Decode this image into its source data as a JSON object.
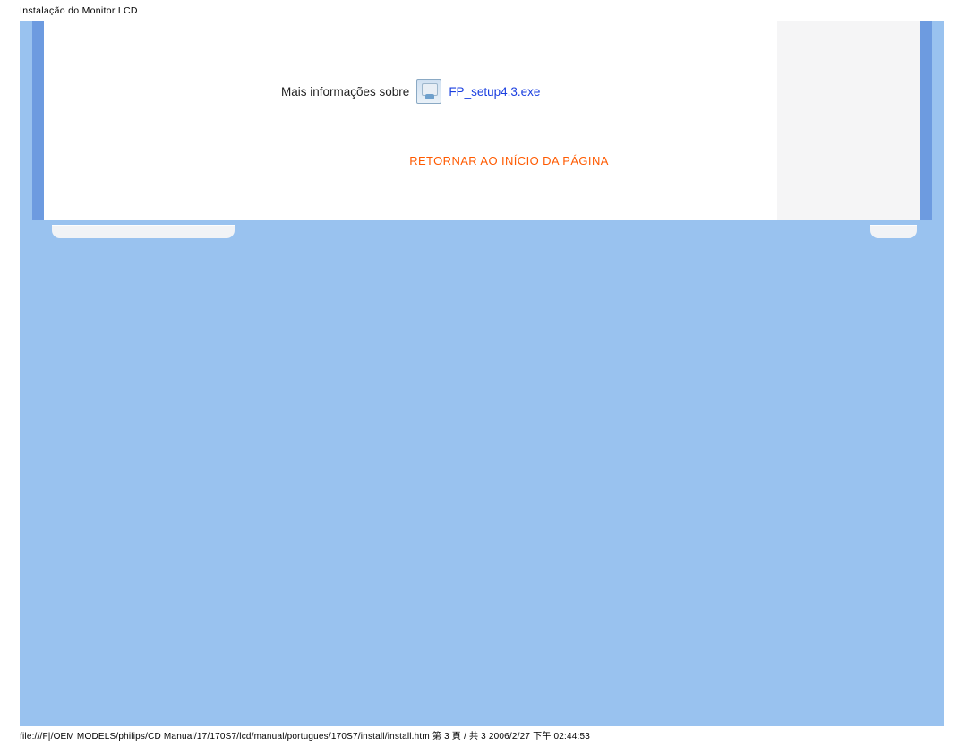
{
  "page": {
    "title": "Instalação do Monitor LCD"
  },
  "content": {
    "info_prefix": "Mais informações sobre",
    "exe_label": "FP_setup4.3.exe",
    "back_to_top": "RETORNAR AO INÍCIO DA PÁGINA"
  },
  "footer": {
    "text": "file:///F|/OEM MODELS/philips/CD Manual/17/170S7/lcd/manual/portugues/170S7/install/install.htm 第 3 頁 / 共 3 2006/2/27 下午 02:44:53"
  }
}
